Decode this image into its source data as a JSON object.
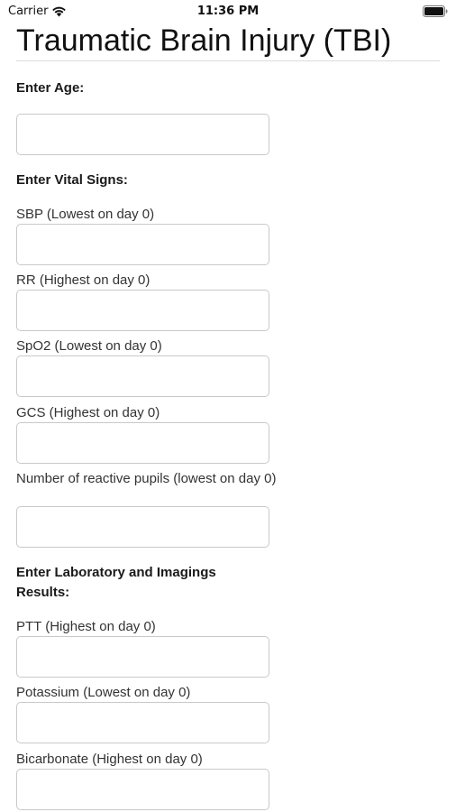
{
  "status_bar": {
    "carrier": "Carrier",
    "time": "11:36 PM",
    "wifi_icon": "wifi-icon",
    "battery_icon": "battery-full-icon"
  },
  "title": "Traumatic Brain Injury (TBI)",
  "sections": {
    "age": {
      "heading": "Enter Age:",
      "field": {
        "value": "",
        "placeholder": ""
      }
    },
    "vitals": {
      "heading": "Enter Vital Signs:",
      "fields": [
        {
          "label": "SBP (Lowest on day 0)",
          "value": "",
          "placeholder": ""
        },
        {
          "label": "RR (Highest on day 0)",
          "value": "",
          "placeholder": ""
        },
        {
          "label": "SpO2 (Lowest on day 0)",
          "value": "",
          "placeholder": ""
        },
        {
          "label": "GCS (Highest on day 0)",
          "value": "",
          "placeholder": ""
        },
        {
          "label": "Number of reactive pupils (lowest on day 0)",
          "value": "",
          "placeholder": ""
        }
      ]
    },
    "labs": {
      "heading": "Enter Laboratory and Imagings Results:",
      "fields": [
        {
          "label": "PTT (Highest on day 0)",
          "value": "",
          "placeholder": ""
        },
        {
          "label": "Potassium (Lowest on day 0)",
          "value": "",
          "placeholder": ""
        },
        {
          "label": "Bicarbonate (Highest on day 0)",
          "value": "",
          "placeholder": ""
        }
      ]
    }
  }
}
